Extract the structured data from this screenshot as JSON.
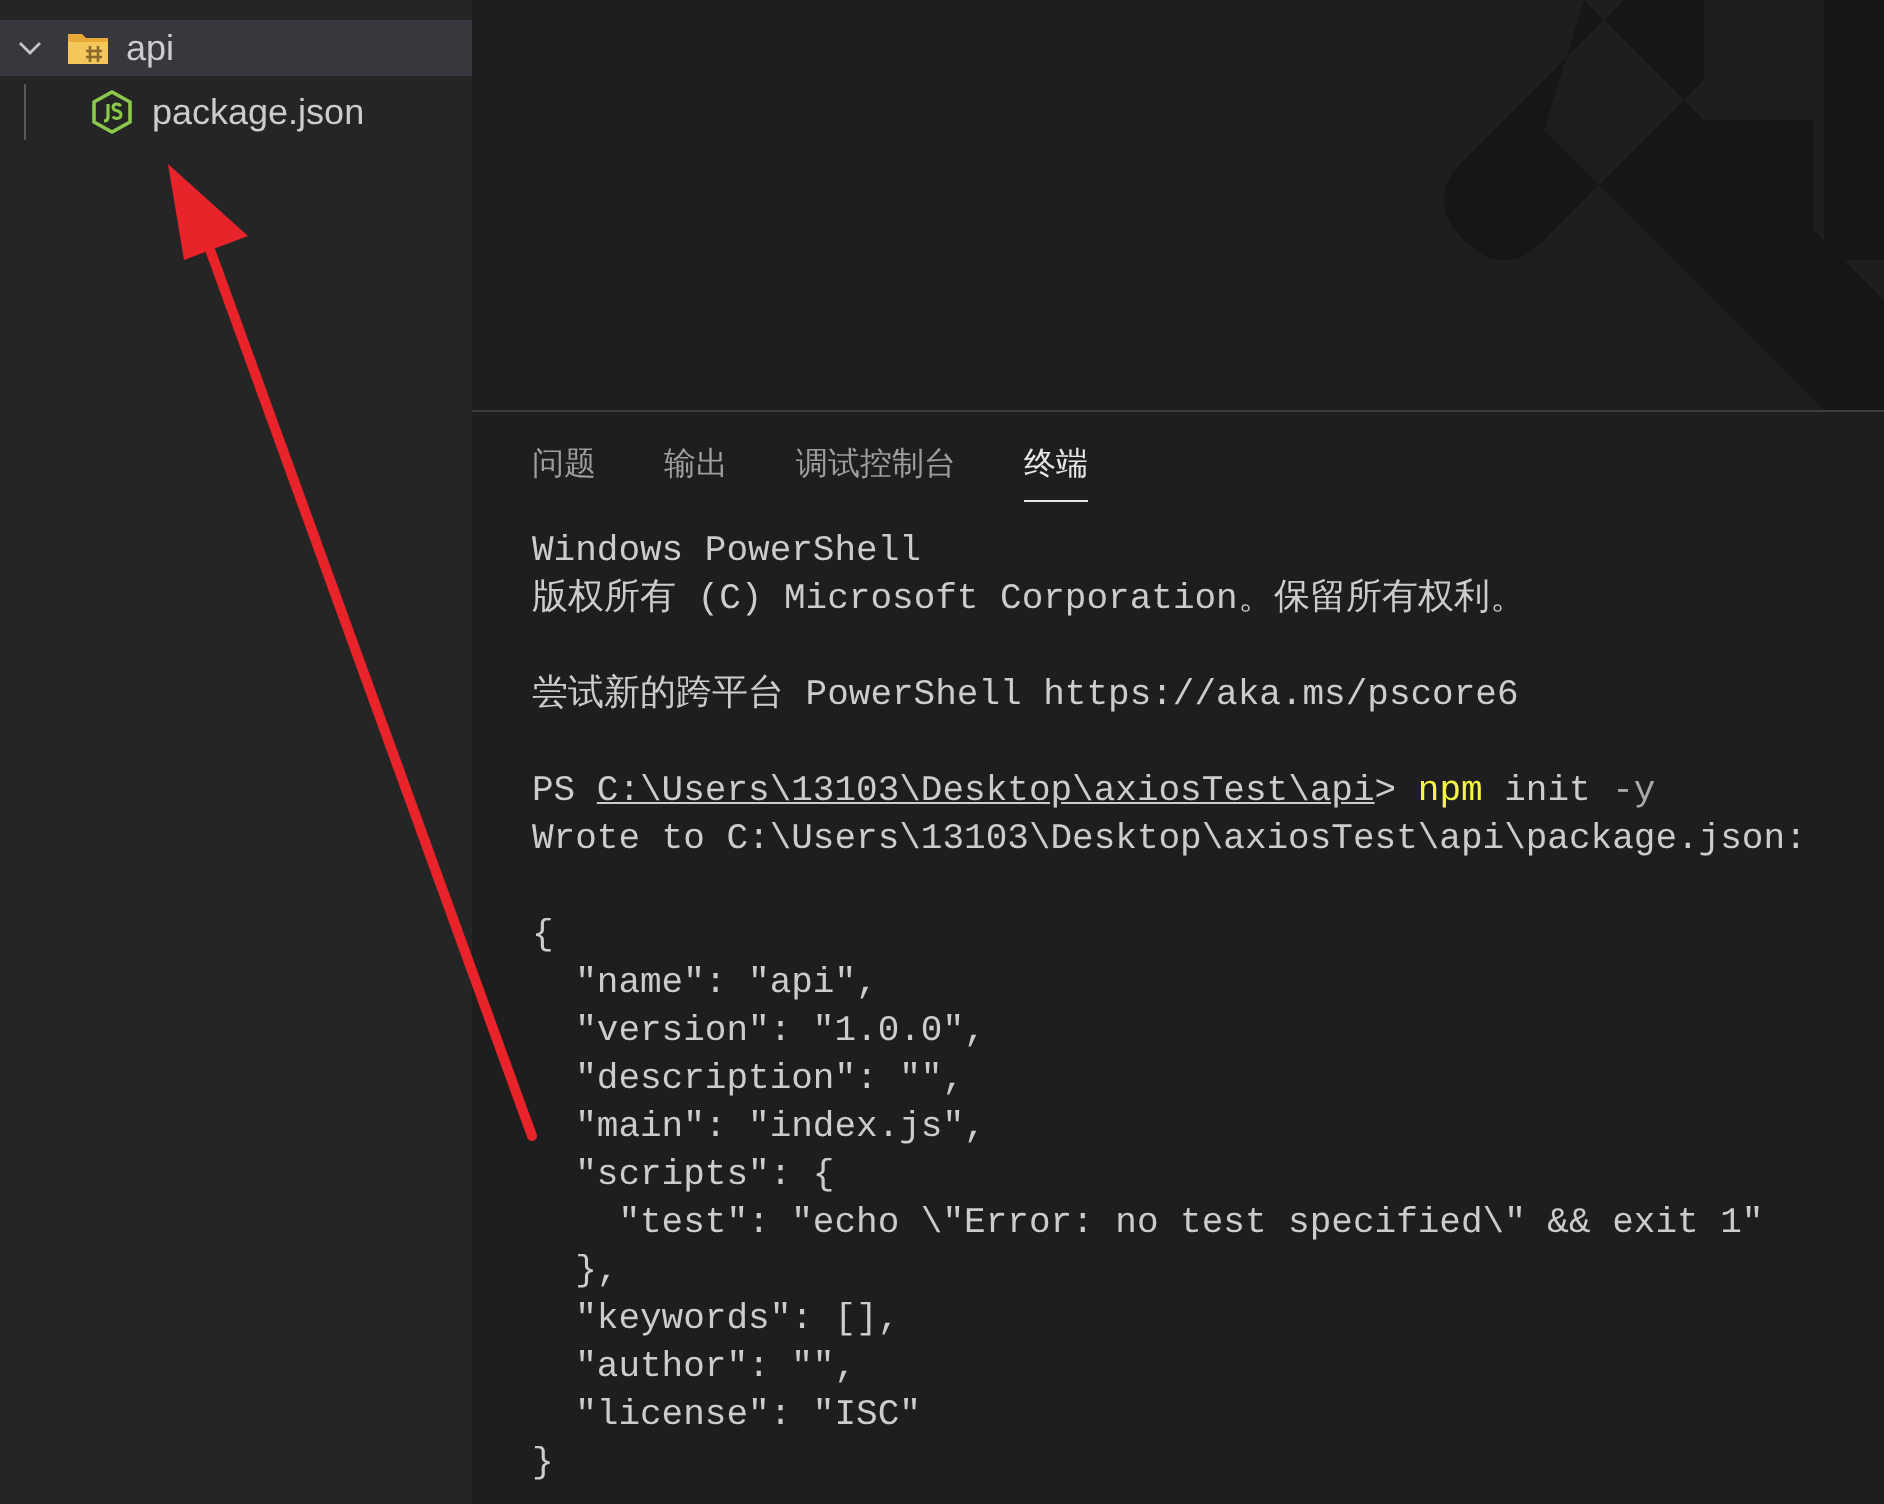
{
  "explorer": {
    "folder": {
      "label": "api",
      "expanded": true,
      "selected": true,
      "children": [
        {
          "label": "package.json",
          "selected": false
        }
      ]
    }
  },
  "panel": {
    "tabs": [
      {
        "label": "问题",
        "selected": false
      },
      {
        "label": "输出",
        "selected": false
      },
      {
        "label": "调试控制台",
        "selected": false
      },
      {
        "label": "终端",
        "selected": true
      }
    ],
    "terminal_lines": [
      {
        "kind": "text",
        "segments": [
          {
            "kind": "plain",
            "text": "Windows PowerShell"
          }
        ]
      },
      {
        "kind": "text",
        "segments": [
          {
            "kind": "plain",
            "text": "版权所有 (C) Microsoft Corporation。保留所有权利。"
          }
        ]
      },
      {
        "kind": "blank"
      },
      {
        "kind": "text",
        "segments": [
          {
            "kind": "plain",
            "text": "尝试新的跨平台 PowerShell https://aka.ms/pscore6"
          }
        ]
      },
      {
        "kind": "blank"
      },
      {
        "kind": "text",
        "segments": [
          {
            "kind": "plain",
            "text": "PS "
          },
          {
            "kind": "link",
            "text": "C:\\Users\\13103\\Desktop\\axiosTest\\api"
          },
          {
            "kind": "plain",
            "text": "> "
          },
          {
            "kind": "command",
            "text": "npm"
          },
          {
            "kind": "plain",
            "text": " init "
          },
          {
            "kind": "flag",
            "text": "-y"
          }
        ]
      },
      {
        "kind": "text",
        "segments": [
          {
            "kind": "plain",
            "text": "Wrote to C:\\Users\\13103\\Desktop\\axiosTest\\api\\package.json:"
          }
        ]
      },
      {
        "kind": "blank"
      },
      {
        "kind": "text",
        "segments": [
          {
            "kind": "plain",
            "text": "{"
          }
        ]
      },
      {
        "kind": "text",
        "segments": [
          {
            "kind": "plain",
            "text": "  \"name\": \"api\","
          }
        ]
      },
      {
        "kind": "text",
        "segments": [
          {
            "kind": "plain",
            "text": "  \"version\": \"1.0.0\","
          }
        ]
      },
      {
        "kind": "text",
        "segments": [
          {
            "kind": "plain",
            "text": "  \"description\": \"\","
          }
        ]
      },
      {
        "kind": "text",
        "segments": [
          {
            "kind": "plain",
            "text": "  \"main\": \"index.js\","
          }
        ]
      },
      {
        "kind": "text",
        "segments": [
          {
            "kind": "plain",
            "text": "  \"scripts\": {"
          }
        ]
      },
      {
        "kind": "text",
        "segments": [
          {
            "kind": "plain",
            "text": "    \"test\": \"echo \\\"Error: no test specified\\\" && exit 1\""
          }
        ]
      },
      {
        "kind": "text",
        "segments": [
          {
            "kind": "plain",
            "text": "  },"
          }
        ]
      },
      {
        "kind": "text",
        "segments": [
          {
            "kind": "plain",
            "text": "  \"keywords\": [],"
          }
        ]
      },
      {
        "kind": "text",
        "segments": [
          {
            "kind": "plain",
            "text": "  \"author\": \"\","
          }
        ]
      },
      {
        "kind": "text",
        "segments": [
          {
            "kind": "plain",
            "text": "  \"license\": \"ISC\""
          }
        ]
      },
      {
        "kind": "text",
        "segments": [
          {
            "kind": "plain",
            "text": "}"
          }
        ]
      }
    ]
  }
}
